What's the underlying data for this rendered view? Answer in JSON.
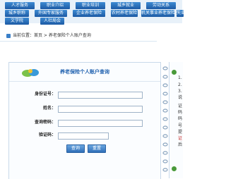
{
  "nav": {
    "row1": [
      "人才服务",
      "职业介绍",
      "职业培训",
      "城乡就业",
      "劳动关系"
    ],
    "row2": [
      "城乡职称",
      "外国专家服务",
      "企业养老保险",
      "农村养老保险",
      "机关事业养老保险",
      "失业"
    ],
    "row3": [
      "文学院",
      "人社局会"
    ]
  },
  "breadcrumb": "当前位置：首页 > 养老保险个人账户查询",
  "form": {
    "title": "养老保险个人账户查询",
    "fields": [
      {
        "label": "身份证号：",
        "value": ""
      },
      {
        "label": "姓名：",
        "value": ""
      },
      {
        "label": "查询密码：",
        "value": ""
      },
      {
        "label": "验证码：",
        "value": ""
      }
    ],
    "submit_label": "查询",
    "reset_label": "重置"
  },
  "side": {
    "lines": [
      "1.",
      "2.",
      "3.",
      "说",
      "证",
      "码",
      "码",
      "号",
      "提",
      "证",
      "后"
    ]
  },
  "colors": {
    "nav_blue": "#1c5aa4",
    "title_blue": "#2263b0",
    "border": "#c9d9ea",
    "accent_red": "#c62a2a"
  }
}
